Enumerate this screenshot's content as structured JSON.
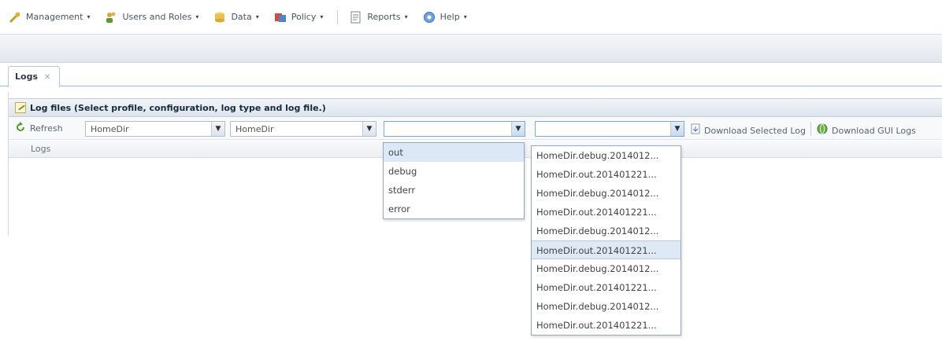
{
  "menubar": {
    "items": [
      {
        "label": "Management",
        "icon": "wrench-icon"
      },
      {
        "label": "Users and Roles",
        "icon": "users-icon"
      },
      {
        "label": "Data",
        "icon": "database-icon"
      },
      {
        "label": "Policy",
        "icon": "policy-icon"
      },
      {
        "label": "Reports",
        "icon": "reports-icon"
      },
      {
        "label": "Help",
        "icon": "help-icon"
      }
    ],
    "caret": "▾"
  },
  "tabs": [
    {
      "label": "Logs",
      "close": "✕"
    }
  ],
  "panel": {
    "title": "Log files (Select profile, configuration, log type and log file.)",
    "toolbar": {
      "refresh_label": "Refresh",
      "profile_value": "HomeDir",
      "configuration_value": "HomeDir",
      "logtype_value": "",
      "logfile_value": "",
      "download_selected_label": "Download Selected Log",
      "download_gui_label": "Download GUI Logs"
    },
    "grid_header": "Logs"
  },
  "logtype_options": [
    "out",
    "debug",
    "stderr",
    "error"
  ],
  "logtype_selected": "out",
  "logfile_options": [
    "HomeDir.debug.2014012...",
    "HomeDir.out.201401221...",
    "HomeDir.debug.2014012...",
    "HomeDir.out.201401221...",
    "HomeDir.debug.2014012...",
    "HomeDir.out.201401221...",
    "HomeDir.debug.2014012...",
    "HomeDir.out.201401221...",
    "HomeDir.debug.2014012...",
    "HomeDir.out.201401221..."
  ],
  "logfile_highlighted_index": 5,
  "colors": {
    "accent": "#99bbe8",
    "selection": "#dde8f6"
  }
}
